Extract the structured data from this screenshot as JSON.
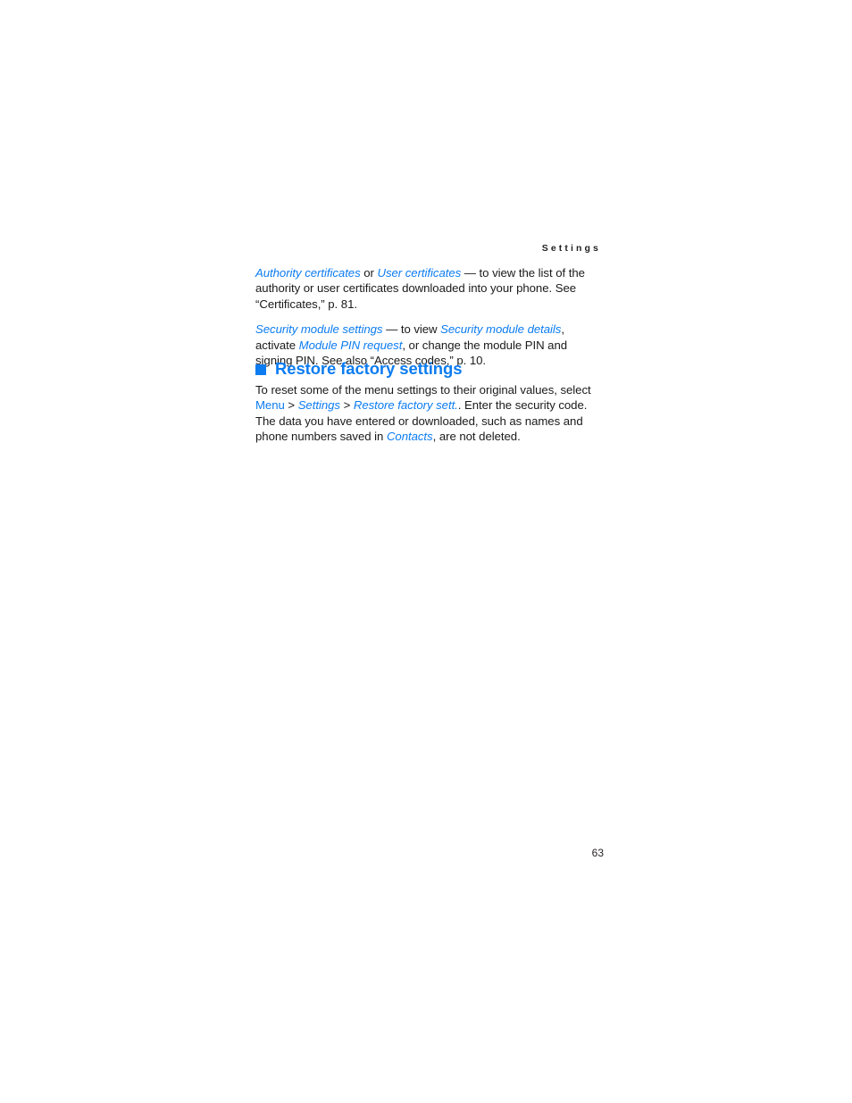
{
  "page": {
    "running_head": "Settings",
    "folio": "63",
    "accent_color": "#0c7cf0",
    "text_color": "#1a1a1a",
    "background_color": "#ffffff"
  },
  "content": {
    "paragraphs": [
      {
        "id": "certificates",
        "runs": [
          {
            "text": "Authority certificates",
            "style": "ref-italic"
          },
          {
            "text": " or ",
            "style": "plain"
          },
          {
            "text": "User certificates",
            "style": "ref-italic"
          },
          {
            "text": " — to view the list of the authority or user certificates downloaded into your phone. See “Certificates,” p. 81.",
            "style": "plain"
          }
        ]
      },
      {
        "id": "security-module-settings",
        "runs": [
          {
            "text": "Security module settings",
            "style": "ref-italic"
          },
          {
            "text": " — to view ",
            "style": "plain"
          },
          {
            "text": "Security module details",
            "style": "ref-italic"
          },
          {
            "text": ", activate ",
            "style": "plain"
          },
          {
            "text": "Module PIN request",
            "style": "ref-italic"
          },
          {
            "text": ", or change the module PIN and signing PIN. See also “Access codes,” p. 10.",
            "style": "plain"
          }
        ]
      }
    ]
  },
  "section": {
    "bullet": "square-bullet",
    "title": "Restore factory settings",
    "body_runs": [
      {
        "text": "To reset some of the menu settings to their original values, select ",
        "style": "plain"
      },
      {
        "text": "Menu",
        "style": "ref-upright"
      },
      {
        "text": " > ",
        "style": "plain"
      },
      {
        "text": "Settings",
        "style": "ref-italic"
      },
      {
        "text": " > ",
        "style": "plain"
      },
      {
        "text": "Restore factory sett.",
        "style": "ref-italic"
      },
      {
        "text": ". Enter the security code. The data you have entered or downloaded, such as names and phone numbers saved in ",
        "style": "plain"
      },
      {
        "text": "Contacts",
        "style": "ref-italic"
      },
      {
        "text": ", are not deleted.",
        "style": "plain"
      }
    ]
  }
}
